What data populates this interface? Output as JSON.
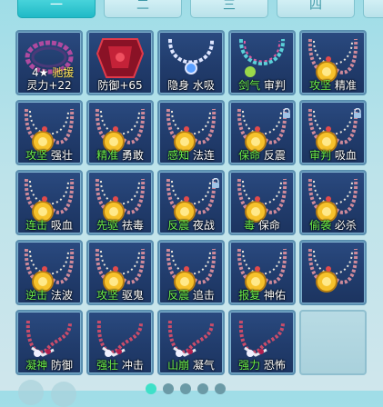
{
  "tabs": [
    {
      "label": "一"
    },
    {
      "label": "二"
    },
    {
      "label": "三"
    },
    {
      "label": "四"
    }
  ],
  "colors": {
    "green": "#6df04a",
    "yellow": "#ffe45a",
    "slot_bg": "#213c6c",
    "tab_active": "#20b9c6"
  },
  "slots": [
    {
      "icon": "chain-bracelet-icon",
      "star": "4★",
      "a": "驰援",
      "b": "",
      "a_color": "y",
      "line2": "灵力+22"
    },
    {
      "icon": "red-armor-icon",
      "a": "防御",
      "b": "+65",
      "a_color": "w"
    },
    {
      "icon": "pearl-necklace-icon",
      "a": "隐身",
      "b": "水吸",
      "a_color": "w"
    },
    {
      "icon": "rainbow-necklace-icon",
      "a": "剑气",
      "b": "审判",
      "a_color": "g"
    },
    {
      "icon": "sun-necklace-icon",
      "a": "攻坚",
      "b": "精准",
      "a_color": "g"
    },
    {
      "icon": "sun-necklace-icon",
      "a": "攻坚",
      "b": "强壮",
      "a_color": "g"
    },
    {
      "icon": "sun-necklace-icon",
      "a": "精准",
      "b": "勇敢",
      "a_color": "g"
    },
    {
      "icon": "sun-necklace-icon",
      "a": "感知",
      "b": "法连",
      "a_color": "g"
    },
    {
      "icon": "sun-necklace-icon",
      "a": "保命",
      "b": "反震",
      "a_color": "g",
      "lock": true
    },
    {
      "icon": "sun-necklace-icon",
      "a": "审判",
      "b": "吸血",
      "a_color": "g",
      "lock": true
    },
    {
      "icon": "sun-necklace-icon",
      "a": "连击",
      "b": "吸血",
      "a_color": "g"
    },
    {
      "icon": "sun-necklace-icon",
      "a": "先驱",
      "b": "祛毒",
      "a_color": "g"
    },
    {
      "icon": "sun-necklace-icon",
      "a": "反震",
      "b": "夜战",
      "a_color": "g",
      "lock": true
    },
    {
      "icon": "sun-necklace-icon",
      "a": "毒",
      "b": "保命",
      "a_color": "g"
    },
    {
      "icon": "sun-necklace-icon",
      "a": "偷袭",
      "b": "必杀",
      "a_color": "g"
    },
    {
      "icon": "sun-necklace-icon",
      "a": "逆击",
      "b": "法波",
      "a_color": "g"
    },
    {
      "icon": "sun-necklace-icon",
      "a": "攻坚",
      "b": "驱鬼",
      "a_color": "g"
    },
    {
      "icon": "sun-necklace-icon",
      "a": "反震",
      "b": "追击",
      "a_color": "g"
    },
    {
      "icon": "sun-necklace-icon",
      "a": "报复",
      "b": "神佑",
      "a_color": "g"
    },
    {
      "icon": "sun-necklace-icon",
      "a": "",
      "b": "",
      "a_color": "g"
    },
    {
      "icon": "bead-chain-icon",
      "a": "凝神",
      "b": "防御",
      "a_color": "g"
    },
    {
      "icon": "bead-chain-icon",
      "a": "强壮",
      "b": "冲击",
      "a_color": "g"
    },
    {
      "icon": "bead-chain-icon",
      "a": "山崩",
      "b": "凝气",
      "a_color": "g"
    },
    {
      "icon": "bead-chain-icon",
      "a": "强力",
      "b": "恐怖",
      "a_color": "g"
    },
    {
      "icon": "",
      "a": "",
      "b": "",
      "empty": true
    }
  ],
  "pager": {
    "current": 1,
    "total": 5
  }
}
